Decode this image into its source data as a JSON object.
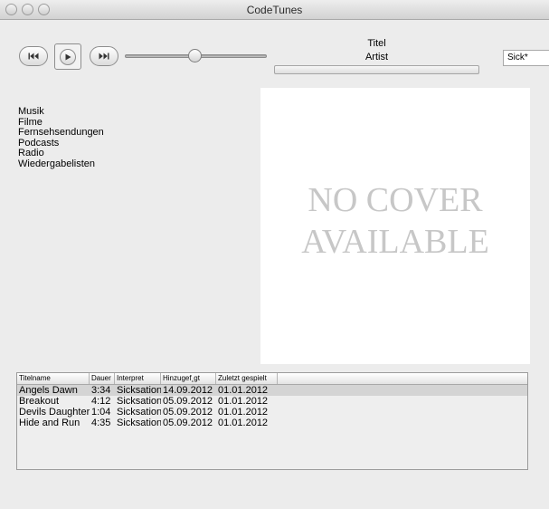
{
  "window": {
    "title": "CodeTunes"
  },
  "controls": {
    "prev_icon": "skip-back-icon",
    "play_icon": "play-icon",
    "next_icon": "skip-forward-icon",
    "volume_level": 0.5
  },
  "now_playing": {
    "title": "Titel",
    "artist": "Artist",
    "progress": 0
  },
  "search": {
    "value": "Sick*"
  },
  "sidebar": {
    "items": [
      {
        "label": "Musik"
      },
      {
        "label": "Filme"
      },
      {
        "label": "Fernsehsendungen"
      },
      {
        "label": "Podcasts"
      },
      {
        "label": "Radio"
      },
      {
        "label": "Wiedergabelisten"
      }
    ]
  },
  "cover": {
    "line1": "NO COVER",
    "line2": "AVAILABLE"
  },
  "table": {
    "columns": [
      "Titelname",
      "Dauer",
      "Interpret",
      "Hinzugef¸gt",
      "Zuletzt gespielt"
    ],
    "rows": [
      {
        "title": "Angels Dawn",
        "duration": "3:34",
        "artist": "Sicksation",
        "added": "14.09.2012",
        "last_played": "01.01.2012",
        "selected": true
      },
      {
        "title": "Breakout",
        "duration": "4:12",
        "artist": "Sicksation",
        "added": "05.09.2012",
        "last_played": "01.01.2012",
        "selected": false
      },
      {
        "title": "Devils Daughter",
        "duration": "1:04",
        "artist": "Sicksation",
        "added": "05.09.2012",
        "last_played": "01.01.2012",
        "selected": false
      },
      {
        "title": "Hide and Run",
        "duration": "4:35",
        "artist": "Sicksation",
        "added": "05.09.2012",
        "last_played": "01.01.2012",
        "selected": false
      }
    ]
  }
}
